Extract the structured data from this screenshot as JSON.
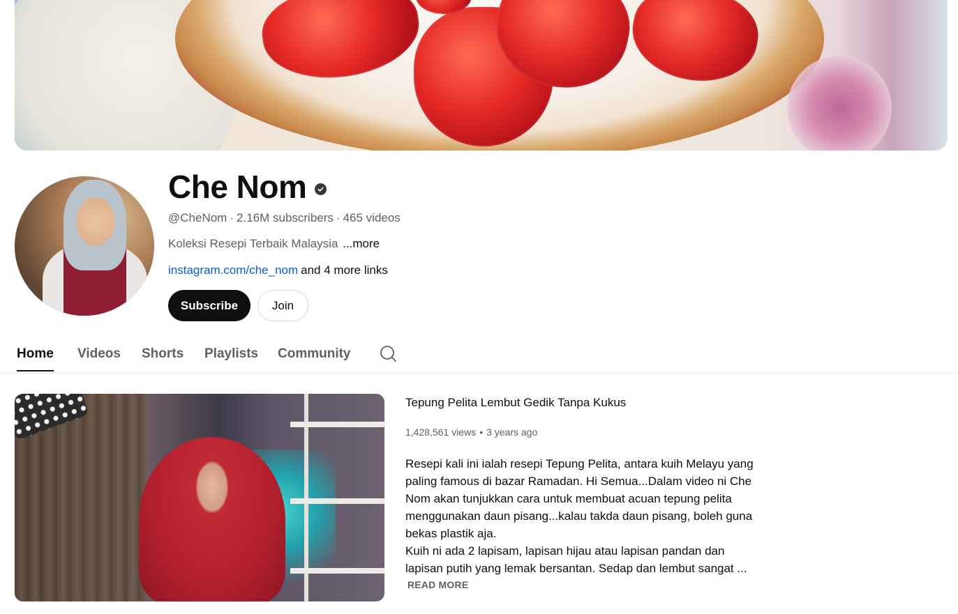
{
  "channel": {
    "name": "Che Nom",
    "handle": "@CheNom",
    "subscribers": "2.16M subscribers",
    "videos": "465 videos",
    "description": "Koleksi Resepi Terbaik Malaysia",
    "more_label": "...more",
    "link": "instagram.com/che_nom",
    "more_links": "and 4 more links",
    "subscribe_label": "Subscribe",
    "join_label": "Join"
  },
  "tabs": [
    {
      "label": "Home",
      "active": true
    },
    {
      "label": "Videos",
      "active": false
    },
    {
      "label": "Shorts",
      "active": false
    },
    {
      "label": "Playlists",
      "active": false
    },
    {
      "label": "Community",
      "active": false
    }
  ],
  "featured": {
    "title": "Tepung Pelita Lembut Gedik Tanpa Kukus",
    "views": "1,428,561 views",
    "age": "3 years ago",
    "description": "Resepi kali ini ialah resepi Tepung Pelita, antara kuih Melayu yang paling famous di bazar Ramadan. Hi Semua...Dalam video ni Che Nom akan tunjukkan cara untuk membuat acuan tepung pelita menggunakan daun pisang...kalau takda daun pisang, boleh guna bekas plastik aja.\nKuih ni ada 2 lapisam, lapisan hijau atau lapisan pandan dan lapisan putih yang lemak bersantan. Sedap dan lembut sangat ...",
    "read_more_label": "READ MORE"
  },
  "icons": {
    "verified": "verified-check-icon",
    "search": "search-icon"
  },
  "colors": {
    "link": "#065fd4",
    "primary_button": "#0f0f0f",
    "secondary_text": "#606060"
  }
}
